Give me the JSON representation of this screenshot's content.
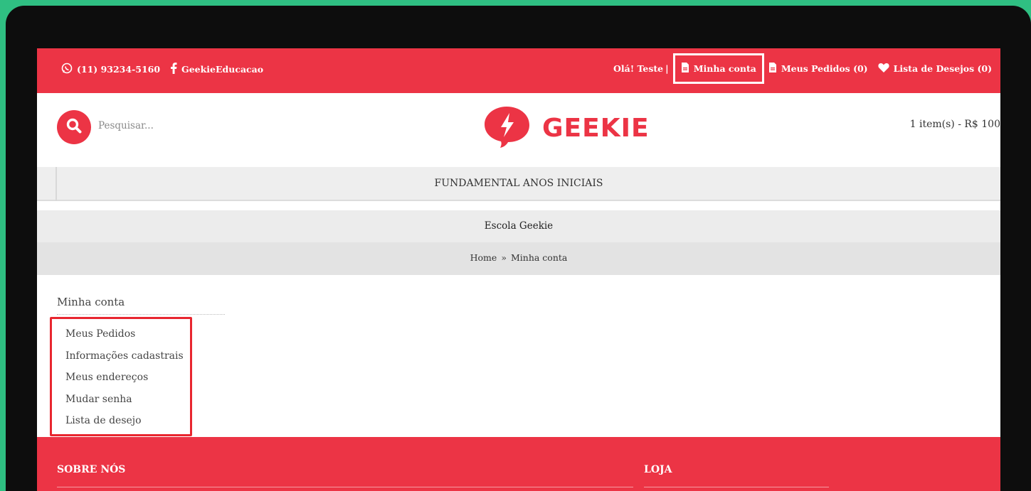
{
  "topbar": {
    "phone": "(11) 93234-5160",
    "facebook": "GeekieEducacao",
    "greeting": "Olá! Teste",
    "separator": "|",
    "my_account": "Minha conta",
    "my_orders": "Meus Pedidos (0)",
    "wishlist": "Lista de Desejos (0)"
  },
  "header": {
    "search_placeholder": "Pesquisar...",
    "logo_text": "GEEKIE",
    "cart": "1 item(s) - R$ 100"
  },
  "nav": {
    "category": "FUNDAMENTAL ANOS INICIAIS"
  },
  "store_name": "Escola Geekie",
  "breadcrumb": {
    "home": "Home",
    "sep": "»",
    "current": "Minha conta"
  },
  "account": {
    "title": "Minha conta",
    "items": [
      "Meus Pedidos",
      "Informações cadastrais",
      "Meus endereços",
      "Mudar senha",
      "Lista de desejo"
    ]
  },
  "footer": {
    "col1": "SOBRE NÓS",
    "col2": "LOJA"
  },
  "colors": {
    "brand": "#ec3445",
    "frame": "#0d0d0d",
    "background": "#2fbf82",
    "highlight_box": "#e8262f"
  }
}
